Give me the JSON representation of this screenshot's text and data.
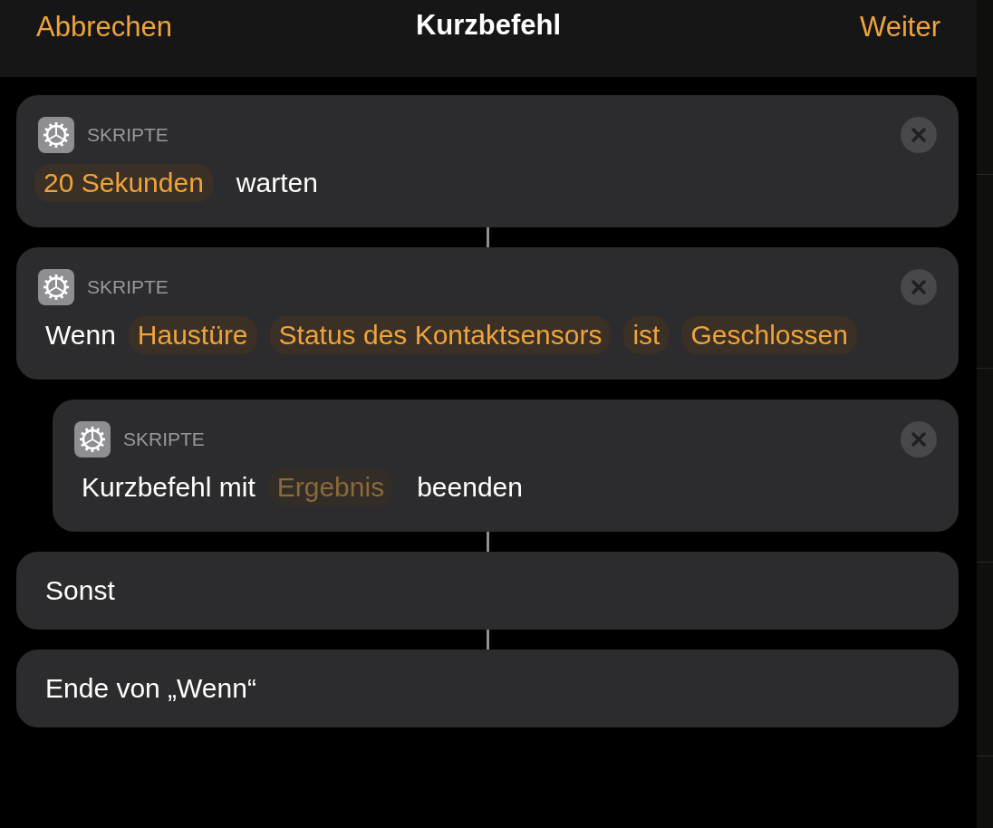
{
  "header": {
    "cancel": "Abbrechen",
    "title": "Kurzbefehl",
    "next": "Weiter"
  },
  "actions": [
    {
      "kind": "action",
      "category": "SKRIPTE",
      "parts": [
        {
          "kind": "token",
          "text": "20 Sekunden",
          "dimmed": false
        },
        {
          "kind": "text",
          "text": "warten"
        }
      ]
    },
    {
      "kind": "action",
      "category": "SKRIPTE",
      "parts": [
        {
          "kind": "text",
          "text": "Wenn"
        },
        {
          "kind": "token",
          "text": "Haustüre",
          "dimmed": false
        },
        {
          "kind": "token",
          "text": "Status des Kontaktsensors",
          "dimmed": false
        },
        {
          "kind": "token",
          "text": "ist",
          "dimmed": false
        },
        {
          "kind": "token",
          "text": "Geschlossen",
          "dimmed": false
        }
      ],
      "children": [
        {
          "kind": "action",
          "category": "SKRIPTE",
          "parts": [
            {
              "kind": "text",
              "text": "Kurzbefehl mit"
            },
            {
              "kind": "token",
              "text": "Ergebnis",
              "dimmed": true
            },
            {
              "kind": "text",
              "text": "beenden"
            }
          ]
        }
      ]
    },
    {
      "kind": "plain",
      "parts": [
        {
          "kind": "text",
          "text": "Sonst"
        }
      ]
    },
    {
      "kind": "plain",
      "parts": [
        {
          "kind": "text",
          "text": "Ende von „Wenn“"
        }
      ]
    }
  ]
}
